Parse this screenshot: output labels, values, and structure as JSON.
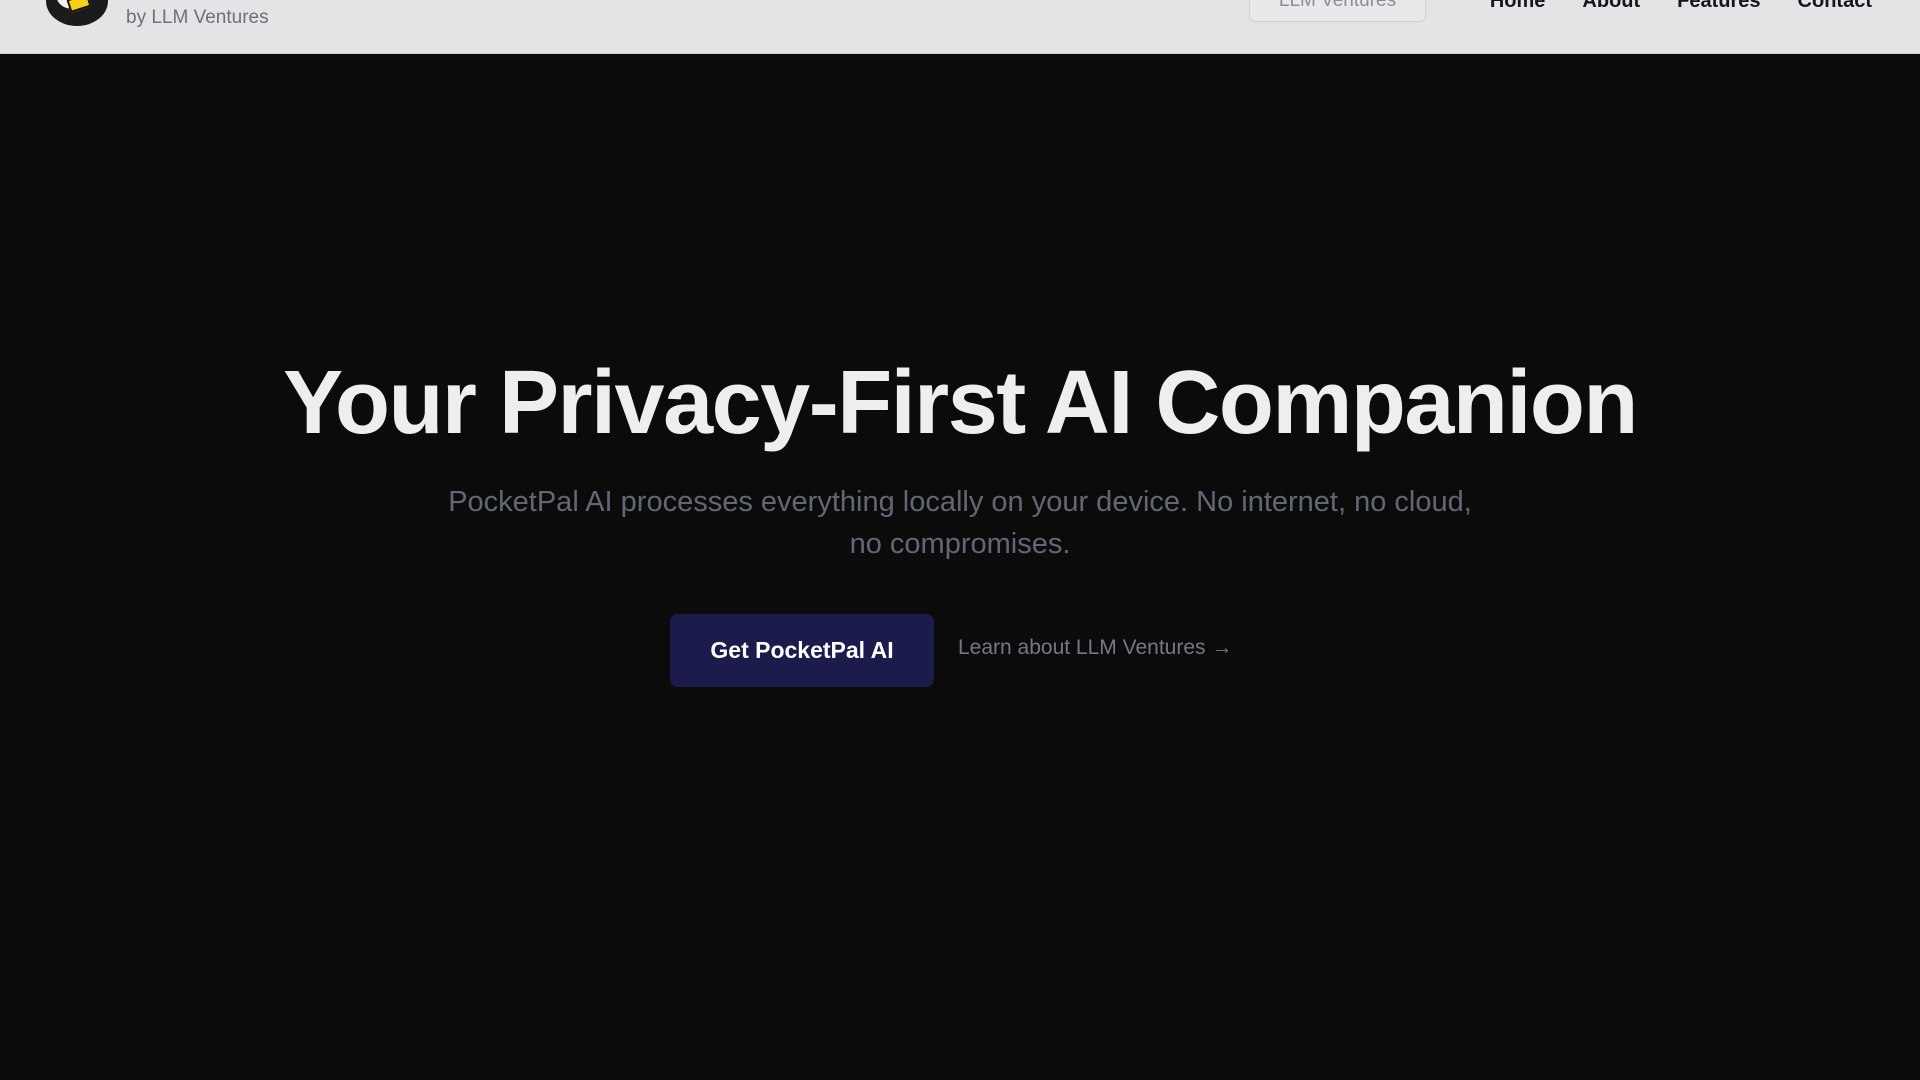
{
  "header": {
    "brand_subtitle": "by LLM Ventures",
    "chip_label": "LLM Ventures",
    "nav": [
      "Home",
      "About",
      "Features",
      "Contact"
    ]
  },
  "hero": {
    "title": "Your Privacy-First AI Companion",
    "subtitle": "PocketPal AI processes everything locally on your device. No internet, no cloud, no compromises.",
    "cta_label": "Get PocketPal AI",
    "learn_link": "Learn about LLM Ventures →"
  },
  "icons": {
    "logo": "pocketpal-logo-icon"
  },
  "colors": {
    "background": "#0b0b0c",
    "header_bg": "#e4e4e6",
    "cta_bg": "#1b1b4c",
    "title": "#eeeeee",
    "subtitle": "#626774"
  }
}
